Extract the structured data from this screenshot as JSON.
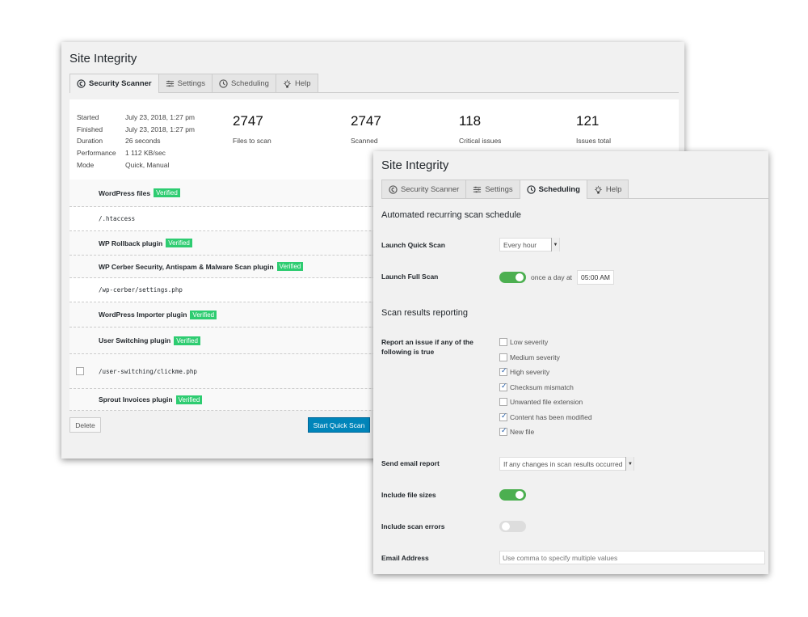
{
  "back": {
    "title": "Site Integrity",
    "tabs": [
      "Security Scanner",
      "Settings",
      "Scheduling",
      "Help"
    ],
    "active_tab": "Security Scanner",
    "meta": [
      [
        "Started",
        "July 23, 2018, 1:27 pm"
      ],
      [
        "Finished",
        "July 23, 2018, 1:27 pm"
      ],
      [
        "Duration",
        "26 seconds"
      ],
      [
        "Performance",
        "1 112 KB/sec"
      ],
      [
        "Mode",
        "Quick, Manual"
      ]
    ],
    "stats": [
      {
        "value": "2747",
        "label": "Files to scan"
      },
      {
        "value": "2747",
        "label": "Scanned"
      },
      {
        "value": "118",
        "label": "Critical issues"
      },
      {
        "value": "121",
        "label": "Issues total"
      }
    ],
    "badge": "Verified",
    "rows": [
      {
        "type": "header",
        "text": "WordPress files",
        "badge": true
      },
      {
        "type": "file",
        "text": "/.htaccess"
      },
      {
        "type": "header",
        "text": "WP Rollback plugin",
        "badge": true
      },
      {
        "type": "header",
        "text": "WP Cerber Security, Antispam & Malware Scan plugin",
        "badge": true
      },
      {
        "type": "file",
        "text": "/wp-cerber/settings.php"
      },
      {
        "type": "header",
        "text": "WordPress Importer plugin",
        "badge": true
      },
      {
        "type": "header",
        "text": "User Switching plugin",
        "badge": true
      },
      {
        "type": "file",
        "text": "/user-switching/clickme.php",
        "checkbox": true
      },
      {
        "type": "header",
        "text": "Sprout Invoices plugin",
        "badge": true
      }
    ],
    "delete_label": "Delete",
    "scan_label": "Start Quick Scan",
    "accent": "#0085ba",
    "badge_color": "#2ecc71"
  },
  "front": {
    "title": "Site Integrity",
    "tabs": [
      "Security Scanner",
      "Settings",
      "Scheduling",
      "Help"
    ],
    "active_tab": "Scheduling",
    "section1": "Automated recurring scan schedule",
    "quick_label": "Launch Quick Scan",
    "quick_value": "Every hour",
    "full_label": "Launch Full Scan",
    "full_on": true,
    "full_text": "once a day at",
    "full_time": "05:00 AM",
    "section2": "Scan results reporting",
    "report_label": "Report an issue if any of the following is true",
    "checks": [
      {
        "label": "Low severity",
        "checked": false
      },
      {
        "label": "Medium severity",
        "checked": false
      },
      {
        "label": "High severity",
        "checked": true
      },
      {
        "label": "Checksum mismatch",
        "checked": true
      },
      {
        "label": "Unwanted file extension",
        "checked": false
      },
      {
        "label": "Content has been modified",
        "checked": true
      },
      {
        "label": "New file",
        "checked": true
      }
    ],
    "email_report_label": "Send email report",
    "email_report_value": "If any changes in scan results occurred",
    "sizes_label": "Include file sizes",
    "sizes_on": true,
    "errors_label": "Include scan errors",
    "errors_on": false,
    "email_label": "Email Address",
    "email_placeholder": "Use comma to specify multiple values",
    "toggle_on_color": "#4caf50"
  }
}
